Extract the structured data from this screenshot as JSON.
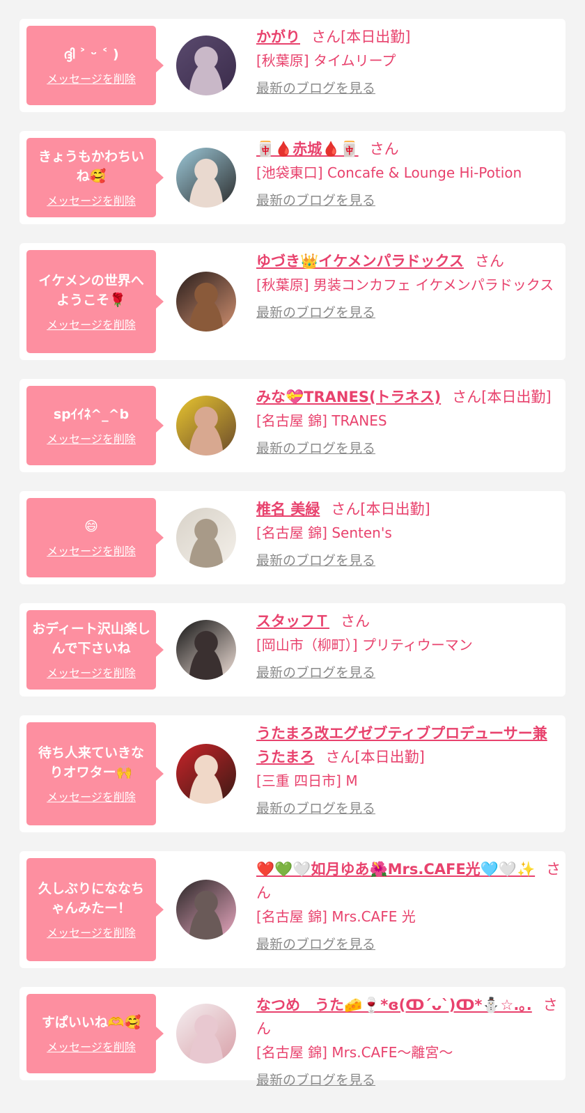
{
  "messages": [
    {
      "message": "ദ്ദി ˃ ᵕ ˂ )",
      "delete_label": "メッセージを削除",
      "name": "かがり",
      "honorific": "さん[本日出勤]",
      "shop": "[秋葉原] タイムリープ",
      "blog_label": "最新のブログを見る",
      "avatar_colors": [
        "#5a4a6e",
        "#c9b8c8",
        "#3a2b4a"
      ]
    },
    {
      "message": "きょうもかわちいね🥰",
      "delete_label": "メッセージを削除",
      "name": "🀄🩸赤城🩸🀄",
      "honorific": "さん",
      "shop": "[池袋東口] Concafe & Lounge Hi-Potion",
      "blog_label": "最新のブログを見る",
      "avatar_colors": [
        "#9cc8d8",
        "#e9d9cf",
        "#2b2b2b"
      ]
    },
    {
      "message": "イケメンの世界へようこそ🌹",
      "delete_label": "メッセージを削除",
      "name": "ゆづき👑イケメンパラドックス",
      "honorific": "さん",
      "shop": "[秋葉原] 男装コンカフェ イケメンパラドックス",
      "blog_label": "最新のブログを見る",
      "avatar_colors": [
        "#2a1e1c",
        "#8a5a3a",
        "#d09070"
      ]
    },
    {
      "message": "spｲｲﾈ^_^b",
      "delete_label": "メッセージを削除",
      "name": "みな💝TRANES(トラネス)",
      "honorific": "さん[本日出勤]",
      "shop": "[名古屋 錦] TRANES",
      "blog_label": "最新のブログを見る",
      "avatar_colors": [
        "#e8c530",
        "#d8a890",
        "#6a4a2a"
      ]
    },
    {
      "message": "😄",
      "delete_label": "メッセージを削除",
      "name": "椎名 美緑",
      "honorific": "さん[本日出勤]",
      "shop": "[名古屋 錦] Senten's",
      "blog_label": "最新のブログを見る",
      "avatar_colors": [
        "#d8d2c8",
        "#a89a88",
        "#f4f0ea"
      ]
    },
    {
      "message": "おディート沢山楽しんで下さいね",
      "delete_label": "メッセージを削除",
      "name": "スタッフＴ",
      "honorific": "さん",
      "shop": "[岡山市（柳町）] プリティウーマン",
      "blog_label": "最新のブログを見る",
      "avatar_colors": [
        "#141414",
        "#3a3030",
        "#f0e0d8"
      ]
    },
    {
      "message": "待ち人来ていきなりオワター🙌",
      "delete_label": "メッセージを削除",
      "name": "うたまろ改エグゼブティブプロデューサー兼うたまろ",
      "honorific": "さん[本日出勤]",
      "shop": "[三重 四日市] M",
      "blog_label": "最新のブログを見る",
      "avatar_colors": [
        "#c8242a",
        "#f0d8c8",
        "#3a1a14"
      ]
    },
    {
      "message": "久しぶりにななちゃんみたー！",
      "delete_label": "メッセージを削除",
      "name": "❤️💚🤍如月ゆあ🌺Mrs.CAFE光🩵🤍✨",
      "honorific": "さん",
      "shop": "[名古屋 錦] Mrs.CAFE 光",
      "blog_label": "最新のブログを見る",
      "avatar_colors": [
        "#2a2626",
        "#6a5a58",
        "#e8a8c0"
      ]
    },
    {
      "message": "すぱいいね🫶🥰",
      "delete_label": "メッセージを削除",
      "name": "なつめ　うた🧀🍷*ɞ(ↀ´ᴗ`)ↀ*⛄☆.｡.",
      "honorific": "さん",
      "shop": "[名古屋 錦] Mrs.CAFE～離宮～",
      "blog_label": "最新のブログを見る",
      "avatar_colors": [
        "#f4eef0",
        "#e8c8d0",
        "#d8a0a8"
      ]
    }
  ]
}
